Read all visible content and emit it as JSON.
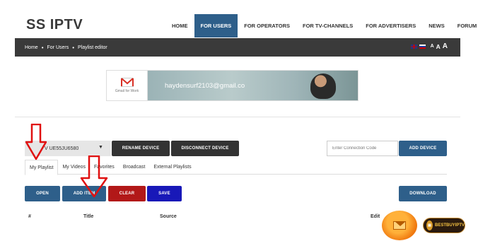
{
  "header": {
    "logo": "SS IPTV",
    "nav": [
      "HOME",
      "FOR USERS",
      "FOR OPERATORS",
      "FOR TV-CHANNELS",
      "FOR ADVERTISERS",
      "NEWS",
      "FORUM"
    ],
    "active_nav": "FOR USERS"
  },
  "breadcrumb": {
    "items": [
      "Home",
      "For Users",
      "Playlist editor"
    ],
    "font_sizes": [
      "A",
      "A",
      "A"
    ]
  },
  "banner": {
    "brand": "Gmail for Work",
    "email": "haydensurf2103@gmail.co"
  },
  "device": {
    "name": "V UE55JU6580",
    "rename_label": "RENAME DEVICE",
    "disconnect_label": "DISCONNECT DEVICE",
    "connection_placeholder": "Enter Connection Code",
    "add_device_label": "ADD DEVICE"
  },
  "tabs": [
    "My Playlist",
    "My Videos",
    "Favorites",
    "Broadcast",
    "External Playlists"
  ],
  "active_tab": "My Playlist",
  "actions": {
    "open": "OPEN",
    "add_item": "ADD ITEM",
    "clear": "CLEAR",
    "save": "SAVE",
    "download": "DOWNLOAD"
  },
  "table": {
    "columns": [
      "#",
      "Title",
      "Source",
      "Edit"
    ]
  },
  "footer_badge": {
    "text": "BESTBUYIPTV"
  },
  "colors": {
    "primary_blue": "#2e5f8a",
    "dark": "#333333",
    "clear_red": "#b21818",
    "save_blue": "#1818b8",
    "arrow_red": "#e01010"
  }
}
